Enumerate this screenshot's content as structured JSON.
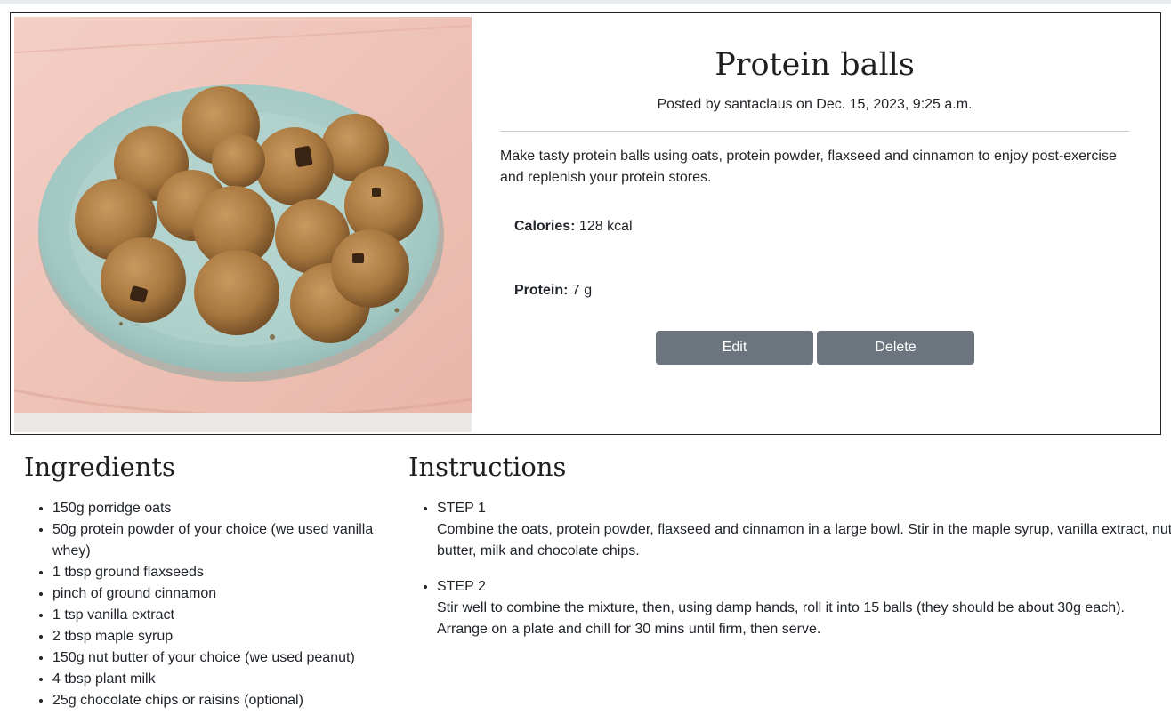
{
  "recipe": {
    "title": "Protein balls",
    "posted": "Posted by santaclaus on Dec. 15, 2023, 9:25 a.m.",
    "description": "Make tasty protein balls using oats, protein powder, flaxseed and cinnamon to enjoy post-exercise and replenish your protein stores.",
    "calories_label": "Calories:",
    "calories_value": "128 kcal",
    "protein_label": "Protein:",
    "protein_value": "7 g",
    "edit_label": "Edit",
    "delete_label": "Delete",
    "image_alt": "protein balls on a plate"
  },
  "ingredients": {
    "heading": "Ingredients",
    "items": [
      "150g porridge oats",
      "50g protein powder of your choice (we used vanilla whey)",
      "1 tbsp ground flaxseeds",
      "pinch of ground cinnamon",
      "1 tsp vanilla extract",
      "2 tbsp maple syrup",
      "150g nut butter of your choice (we used peanut)",
      "4 tbsp plant milk",
      "25g chocolate chips or raisins (optional)"
    ]
  },
  "instructions": {
    "heading": "Instructions",
    "steps": [
      {
        "title": "STEP 1",
        "text": "Combine the oats, protein powder, flaxseed and cinnamon in a large bowl. Stir in the maple syrup, vanilla extract, nut butter, milk and chocolate chips."
      },
      {
        "title": "STEP 2",
        "text": "Stir well to combine the mixture, then, using damp hands, roll it into 15 balls (they should be about 30g each). Arrange on a plate and chill for 30 mins until firm, then serve."
      }
    ]
  },
  "colors": {
    "button": "#6c757d",
    "cloth": "#f0c4b8",
    "plate": "#a9cdc8",
    "ball": "#a8773f"
  }
}
